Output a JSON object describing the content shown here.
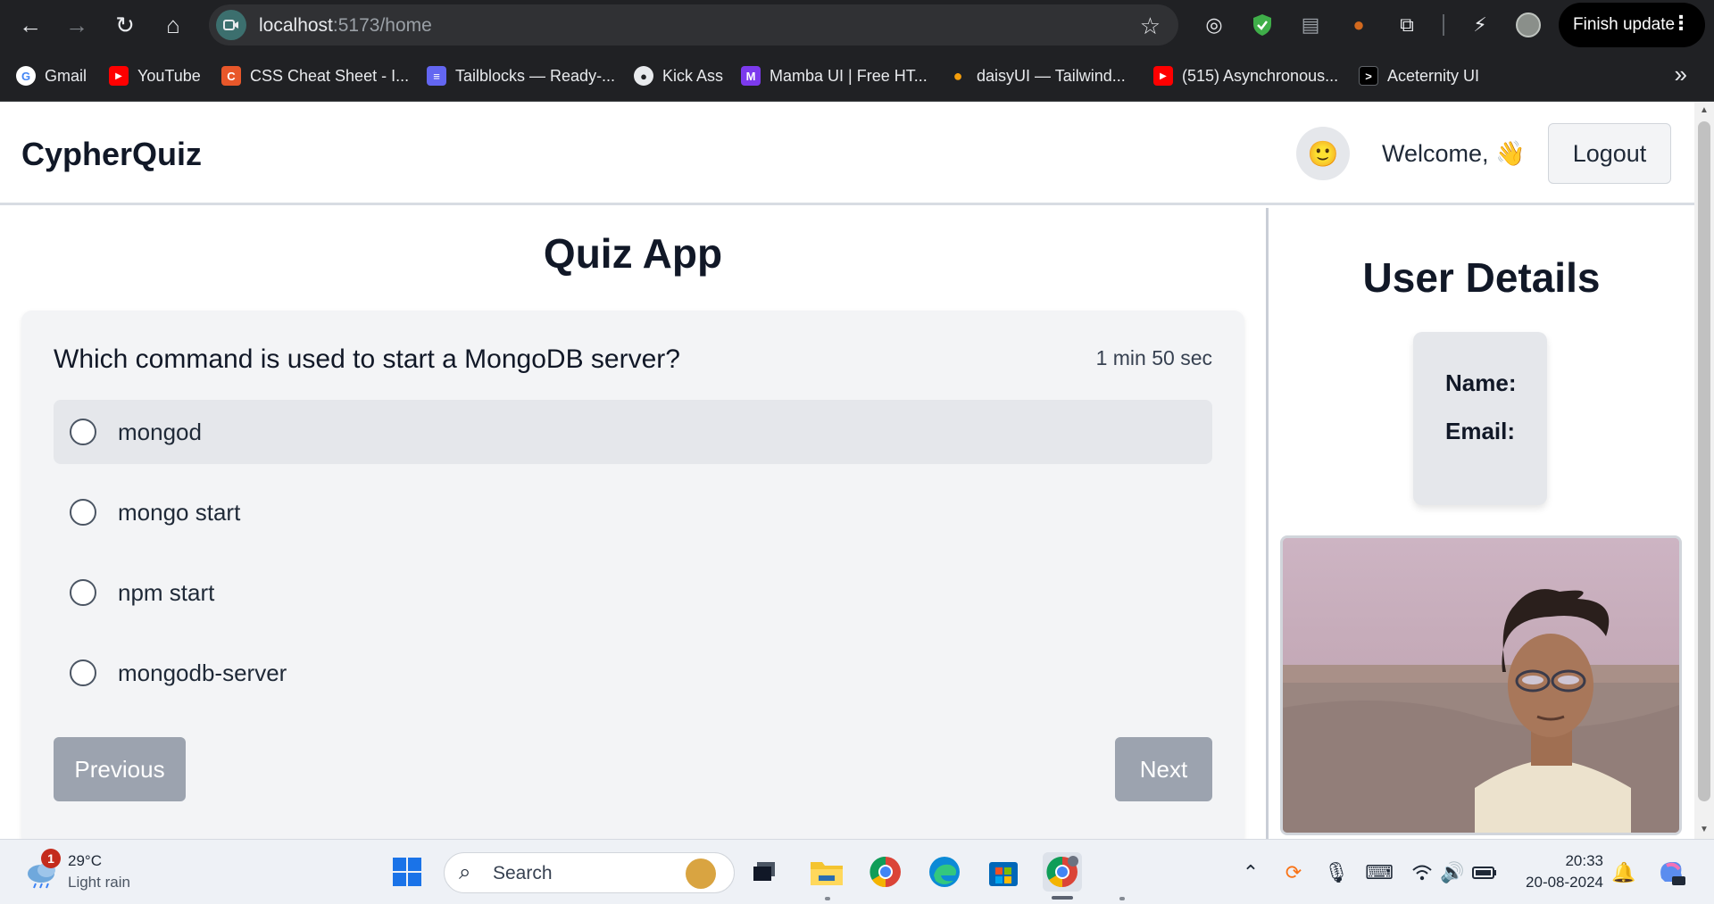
{
  "browser": {
    "url_host": "localhost",
    "url_path": ":5173/home",
    "finish_update_label": "Finish update",
    "bookmarks": [
      {
        "label": "Gmail",
        "icon": "google-icon",
        "color": "#4285f4",
        "glyph": "G"
      },
      {
        "label": "YouTube",
        "icon": "youtube-icon",
        "color": "#ff0000",
        "glyph": "▶"
      },
      {
        "label": "CSS Cheat Sheet - I...",
        "icon": "css-icon",
        "color": "#e8572a",
        "glyph": "C"
      },
      {
        "label": "Tailblocks — Ready-...",
        "icon": "tailblocks-icon",
        "color": "#6366f1",
        "glyph": "≡"
      },
      {
        "label": "Kick Ass",
        "icon": "kickass-icon",
        "color": "#e8eaed",
        "glyph": "●"
      },
      {
        "label": "Mamba UI | Free HT...",
        "icon": "mamba-icon",
        "color": "#7c3aed",
        "glyph": "M"
      },
      {
        "label": "daisyUI — Tailwind...",
        "icon": "daisyui-icon",
        "color": "#f59e0b",
        "glyph": "●"
      },
      {
        "label": "(515) Asynchronous...",
        "icon": "youtube-icon",
        "color": "#ff0000",
        "glyph": "▶"
      },
      {
        "label": "Aceternity UI",
        "icon": "aceternity-icon",
        "color": "#000000",
        "glyph": ">"
      }
    ]
  },
  "app": {
    "brand": "CypherQuiz",
    "welcome": "Welcome, 👋",
    "logout_label": "Logout",
    "quiz_title": "Quiz App",
    "question": "Which command is used to start a MongoDB server?",
    "timer": "1 min 50 sec",
    "options": [
      "mongod",
      "mongo start",
      "npm start",
      "mongodb-server"
    ],
    "previous_label": "Previous",
    "next_label": "Next",
    "user_details_title": "User Details",
    "name_label": "Name:",
    "email_label": "Email:"
  },
  "taskbar": {
    "weather_temp": "29°C",
    "weather_desc": "Light rain",
    "weather_badge": "1",
    "search_placeholder": "Search",
    "time": "20:33",
    "date": "20-08-2024"
  }
}
